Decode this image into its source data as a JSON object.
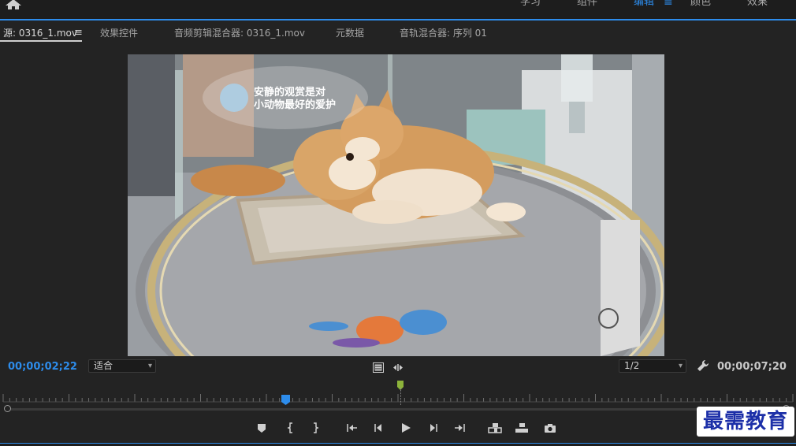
{
  "workspace": {
    "tabs": [
      "学习",
      "组件",
      "编辑",
      "颜色",
      "效果"
    ],
    "active": "编辑",
    "menu_glyph": "≡"
  },
  "panel_tabs": {
    "source": "源: 0316_1.mov",
    "effect_controls": "效果控件",
    "audio_clip_mixer": "音频剪辑混合器: 0316_1.mov",
    "metadata": "元数据",
    "audio_track_mixer": "音轨混合器: 序列 01",
    "menu_glyph": "≡"
  },
  "video": {
    "overlay_text_line1": "安静的观赏是对",
    "overlay_text_line2": "小动物最好的爱护"
  },
  "controls": {
    "current_timecode": "00;00;02;22",
    "zoom_select": "适合",
    "resolution_select": "1/2",
    "duration_timecode": "00;00;07;20"
  },
  "playhead": {
    "position_fraction": 0.358
  },
  "in_point": {
    "position_fraction": 0.503
  },
  "icons": {
    "home": "home-icon",
    "safe_margins": "safe-margins-icon",
    "insert_overwrite": "drag-video-icon",
    "settings": "wrench-icon",
    "marker": "add-marker-icon",
    "mark_in": "mark-in-icon",
    "mark_out": "mark-out-icon",
    "go_to_in": "go-to-in-icon",
    "step_back": "step-back-icon",
    "play": "play-icon",
    "step_forward": "step-forward-icon",
    "go_to_out": "go-to-out-icon",
    "insert": "insert-icon",
    "overwrite": "overwrite-icon",
    "export_frame": "camera-icon"
  },
  "colors": {
    "accent": "#2d8ceb",
    "in_marker": "#8cb33a"
  },
  "watermark": "最需教育"
}
